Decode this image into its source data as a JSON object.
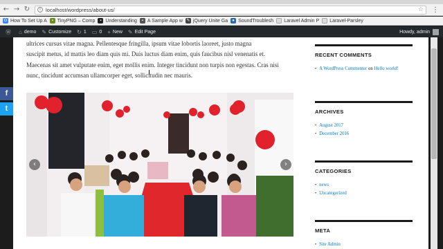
{
  "browser": {
    "url": "localhost/wordpress/about-us/",
    "bookmarks": [
      {
        "label": "How To Set Up A",
        "color": "#4285f4"
      },
      {
        "label": "TinyPNG – Comp",
        "color": "#6b8e23"
      },
      {
        "label": "Understanding",
        "color": "#222222"
      },
      {
        "label": "A Sample App w",
        "color": "#555555"
      },
      {
        "label": "jQuery Unite Ga",
        "color": "#444444"
      },
      {
        "label": "SoundTroublesh",
        "color": "#2b6cb0"
      },
      {
        "label": "Laravel Admin P",
        "color": "#e8e8e8"
      },
      {
        "label": "Laravel-Parsley",
        "color": "#e8e8e8"
      }
    ]
  },
  "adminbar": {
    "site": "demo",
    "customize": "Customize",
    "comments_count": "1",
    "updates_count": "0",
    "new": "New",
    "edit": "Edit Page",
    "howdy": "Howdy, admin"
  },
  "article": {
    "lines": [
      "ultrices cursus vitae magna. Pellentesque fringilla, ipsum vitae lobortis laoreet, justo magna",
      "suscipit metus, id mattis leo diam quis mi. Duis luctus diam enim, quis faucibus nisl venenatis et.",
      "Maecenas sit amet vulputate enim, eget mollis enim. Integer tincidunt non turpis non egestas. Cras nisi",
      "nunc, tincidunt accumsan ullamcorper eget, sollicitudin nec mauris."
    ]
  },
  "sidebar": {
    "recent_comments": {
      "title": "RECENT COMMENTS",
      "author": "A WordPress Commenter",
      "on": "on",
      "post": "Hello world!"
    },
    "archives": {
      "title": "ARCHIVES",
      "items": [
        "August 2017",
        "December 2016"
      ]
    },
    "categories": {
      "title": "CATEGORIES",
      "items": [
        "news",
        "Uncategorized"
      ]
    },
    "meta": {
      "title": "META",
      "items": [
        "Site Admin"
      ]
    }
  },
  "social": {
    "facebook": "f",
    "twitter": "t"
  },
  "colors": {
    "admin_bar": "#23282d",
    "link": "#007acc",
    "facebook": "#3b5998",
    "twitter": "#1da1f2"
  }
}
